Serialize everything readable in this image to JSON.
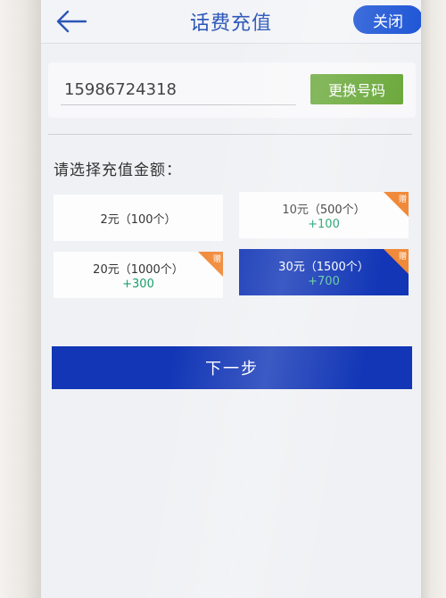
{
  "header": {
    "back_icon": "arrow-left-icon",
    "title": "话费充值",
    "close_label": "关闭"
  },
  "phone": {
    "value": "15986724318",
    "change_label": "更换号码"
  },
  "prompt": "请选择充值金额：",
  "options": [
    {
      "main": "2元（100个）",
      "bonus": "",
      "gift": false,
      "selected": false
    },
    {
      "main": "10元（500个）",
      "bonus": "+100",
      "gift": true,
      "selected": false
    },
    {
      "main": "20元（1000个）",
      "bonus": "+300",
      "gift": true,
      "selected": false
    },
    {
      "main": "30元（1500个）",
      "bonus": "+700",
      "gift": true,
      "selected": true
    }
  ],
  "gift_label": "赠",
  "next_label": "下一步",
  "colors": {
    "accent": "#1236b6",
    "title": "#2b56b8",
    "change_button": "#6aa83a",
    "gift_ribbon": "#f08a3a",
    "bonus_text": "#1a9e6a"
  }
}
